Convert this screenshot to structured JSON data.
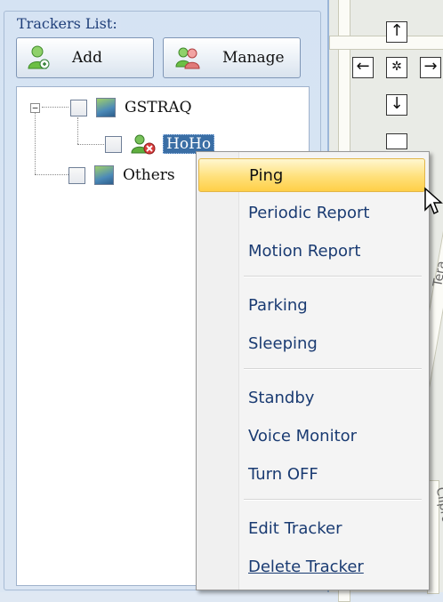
{
  "trackers_panel": {
    "title": "Trackers List:",
    "add_label": "Add",
    "manage_label": "Manage"
  },
  "tree": {
    "nodes": [
      {
        "label": "GSTRAQ",
        "expanded": true
      },
      {
        "label": "HoHo",
        "selected": true
      },
      {
        "label": "Others"
      }
    ]
  },
  "context_menu": {
    "items": [
      "Ping",
      "Periodic Report",
      "Motion Report",
      "Parking",
      "Sleeping",
      "Standby",
      "Voice Monitor",
      "Turn OFF",
      "Edit Tracker",
      "Delete Tracker"
    ],
    "highlighted": "Ping"
  },
  "map": {
    "labels": [
      "Tera",
      "Clipro"
    ],
    "nav_icons": [
      "arrow-up",
      "arrow-left",
      "center",
      "arrow-right",
      "arrow-down",
      "zoom"
    ]
  },
  "colors": {
    "highlight": "#ffd766",
    "selection": "#3a6ea5",
    "menu_text": "#1a3b72"
  }
}
